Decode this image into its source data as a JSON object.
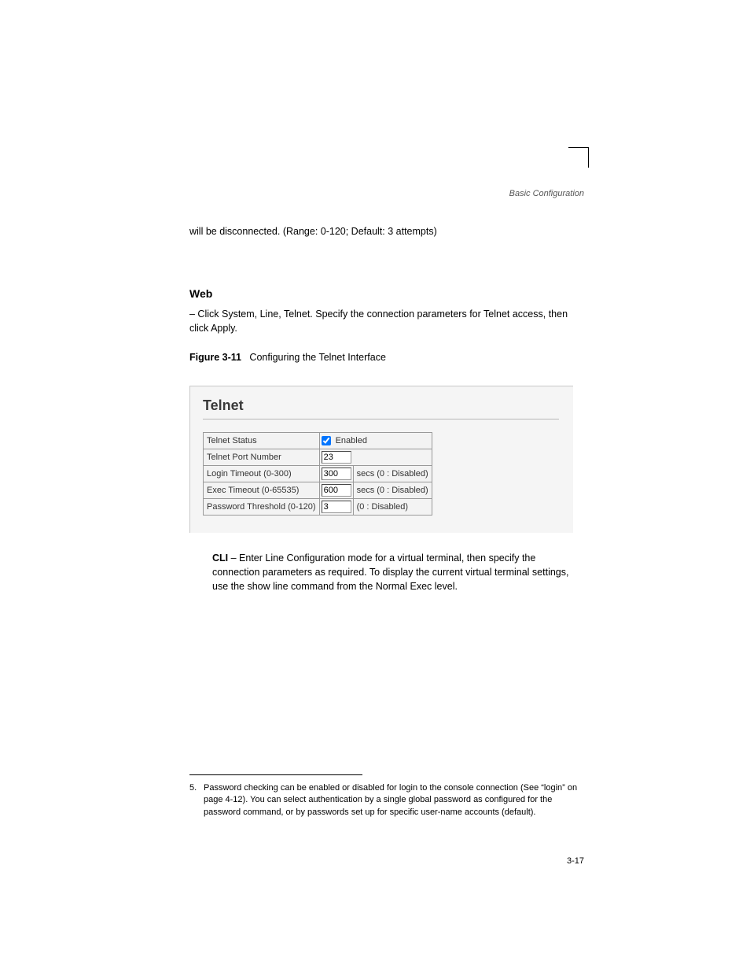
{
  "header": {
    "section_title": "Basic Configuration"
  },
  "intro": "will be disconnected. (Range: 0-120; Default: 3 attempts)",
  "section": {
    "heading": "Web",
    "p1": "– Click System, Line, Telnet. Specify the connection parameters for Telnet access, then click Apply.",
    "p2_label": "Figure 3-11",
    "p2_text": "Configuring the Telnet Interface"
  },
  "telnet": {
    "title": "Telnet",
    "rows": {
      "status": {
        "label": "Telnet Status",
        "chk_label": "Enabled",
        "checked": true
      },
      "port": {
        "label": "Telnet Port Number",
        "value": "23"
      },
      "login": {
        "label": "Login Timeout (0-300)",
        "value": "300",
        "hint": "secs (0 : Disabled)"
      },
      "exec": {
        "label": "Exec Timeout (0-65535)",
        "value": "600",
        "hint": "secs (0 : Disabled)"
      },
      "pwd": {
        "label": "Password Threshold (0-120)",
        "value": "3",
        "hint": "(0 : Disabled)"
      }
    }
  },
  "cli": {
    "heading": "CLI",
    "body": " – Enter Line Configuration mode for a virtual terminal, then specify the connection parameters as required. To display the current virtual terminal settings, use the show line command from the Normal Exec level."
  },
  "footnote": {
    "num": "5.",
    "text": "Password checking can be enabled or disabled for login to the console connection (See “login” on page 4-12). You can select authentication by a single global password as configured for the password command, or by passwords set up for specific user-name accounts (default)."
  },
  "pagenum": "3-17"
}
